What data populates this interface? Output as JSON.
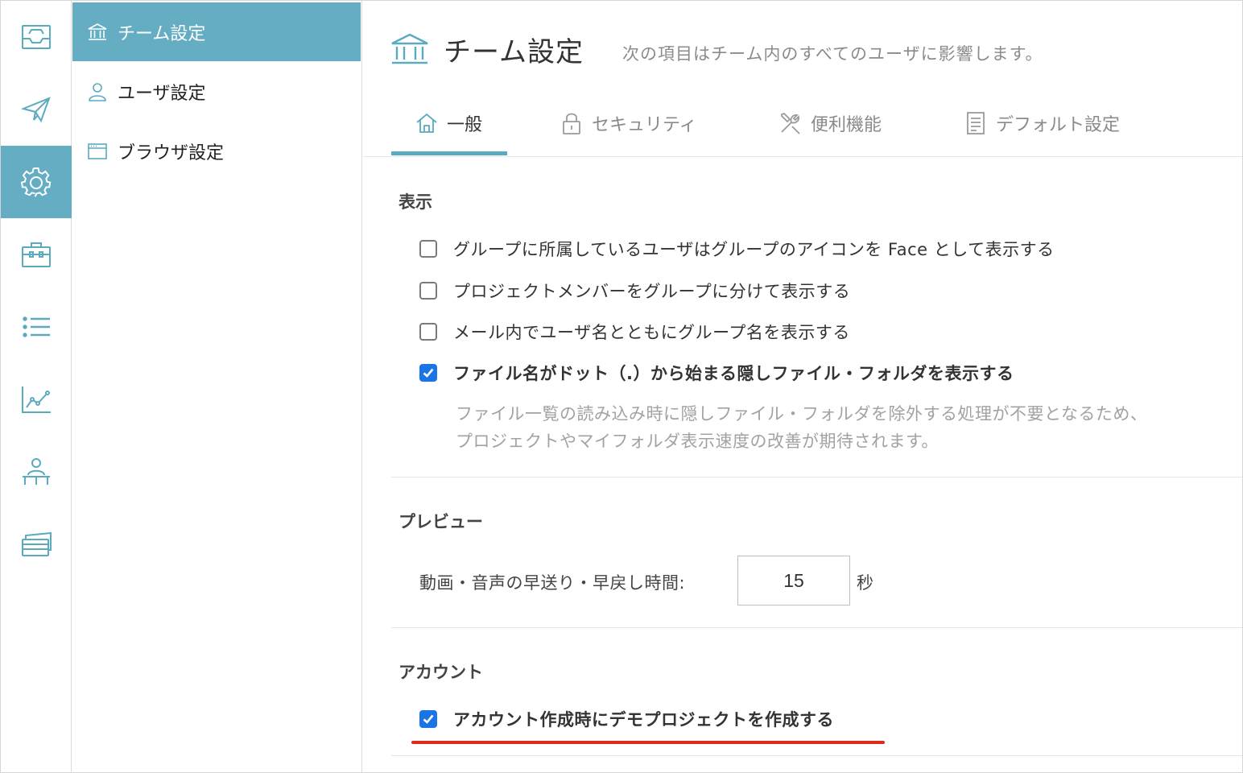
{
  "colors": {
    "accent": "#65adc2",
    "checkbox": "#1b74e4",
    "highlight": "#e02a20"
  },
  "rail": {
    "items": [
      {
        "icon": "inbox-icon"
      },
      {
        "icon": "send-icon"
      },
      {
        "icon": "gear-icon",
        "active": true
      },
      {
        "icon": "briefcase-icon"
      },
      {
        "icon": "list-icon"
      },
      {
        "icon": "chart-icon"
      },
      {
        "icon": "presenter-icon"
      },
      {
        "icon": "cards-icon"
      }
    ]
  },
  "nav": {
    "items": [
      {
        "label": "チーム設定",
        "icon": "bank-icon",
        "active": true
      },
      {
        "label": "ユーザ設定",
        "icon": "user-icon"
      },
      {
        "label": "ブラウザ設定",
        "icon": "browser-icon"
      }
    ]
  },
  "header": {
    "title": "チーム設定",
    "description": "次の項目はチーム内のすべてのユーザに影響します。"
  },
  "tabs": [
    {
      "label": "一般",
      "icon": "home-icon",
      "active": true
    },
    {
      "label": "セキュリティ",
      "icon": "lock-icon"
    },
    {
      "label": "便利機能",
      "icon": "tools-icon"
    },
    {
      "label": "デフォルト設定",
      "icon": "document-icon"
    }
  ],
  "display": {
    "title": "表示",
    "options": [
      {
        "label": "グループに所属しているユーザはグループのアイコンを Face として表示する",
        "checked": false
      },
      {
        "label": "プロジェクトメンバーをグループに分けて表示する",
        "checked": false
      },
      {
        "label": "メール内でユーザ名とともにグループ名を表示する",
        "checked": false
      },
      {
        "label": "ファイル名がドット（.）から始まる隠しファイル・フォルダを表示する",
        "checked": true
      }
    ],
    "help_line1": "ファイル一覧の読み込み時に隠しファイル・フォルダを除外する処理が不要となるため、",
    "help_line2": "プロジェクトやマイフォルダ表示速度の改善が期待されます。"
  },
  "preview": {
    "title": "プレビュー",
    "seek_label": "動画・音声の早送り・早戻し時間:",
    "seek_value": "15",
    "seek_unit": "秒"
  },
  "account": {
    "title": "アカウント",
    "options": [
      {
        "label": "アカウント作成時にデモプロジェクトを作成する",
        "checked": true
      }
    ]
  }
}
